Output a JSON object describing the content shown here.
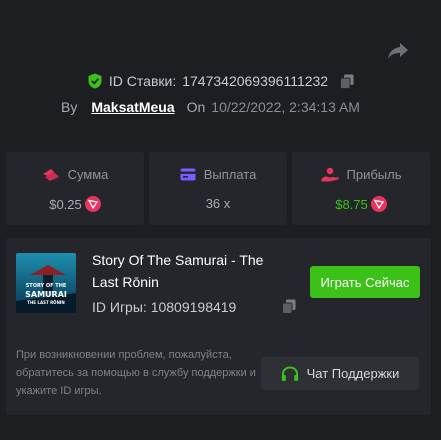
{
  "bet": {
    "id_label": "ID Ставки:",
    "id_value": "1747342069396111232",
    "by_label": "By",
    "username": "MaksatMeua",
    "on_label": "On",
    "timestamp": "10/22/2022, 2:34:13 AM"
  },
  "stats": {
    "amount": {
      "label": "Сумма",
      "value": "$0.25"
    },
    "payout": {
      "label": "Выплата",
      "value": "36 x"
    },
    "profit": {
      "label": "Прибыль",
      "value": "$8.75"
    }
  },
  "game": {
    "title": "Story Of The Samurai - The Last Rōnin",
    "id_label": "ID Игры:",
    "id_value": "10809198419",
    "play_button": "Играть Сейчас",
    "thumbnail": {
      "line1": "STORY OF THE",
      "line2": "SAMURAI",
      "line3": "THE LAST RŌNIN"
    }
  },
  "support": {
    "help_text": "При возникновении проблем, пожалуйста, обратитесь за помощью в службу поддержки и укажите ID игры.",
    "button_label": "Чат Поддержки"
  },
  "colors": {
    "accent_green": "#3bc117",
    "trx_red": "#e8345f",
    "background": "#1d1e22",
    "card": "#24262b"
  }
}
